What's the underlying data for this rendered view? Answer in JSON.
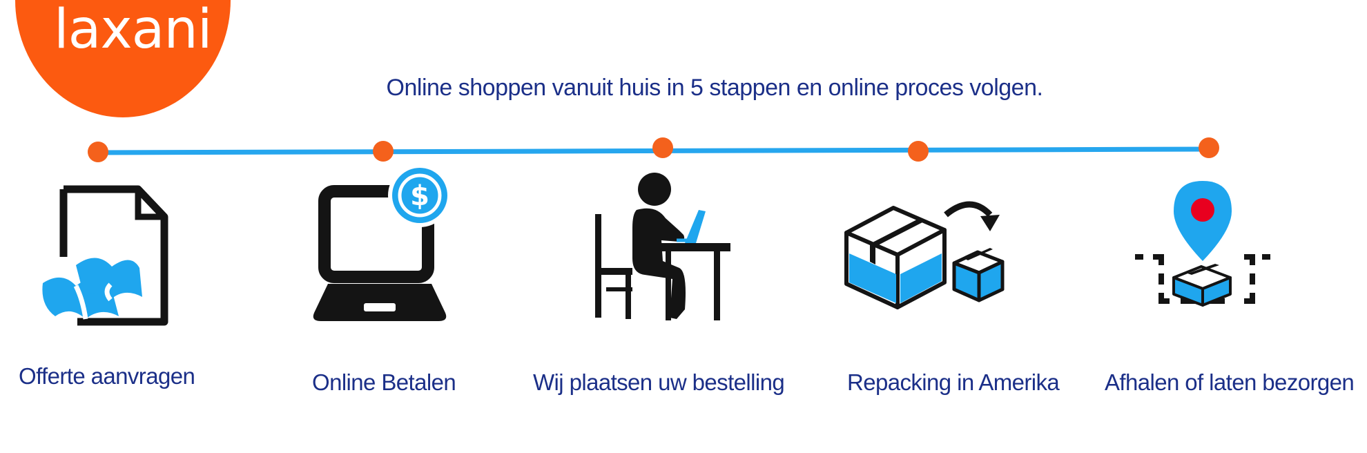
{
  "brand": {
    "name": "laxani",
    "color": "#fc5a10"
  },
  "headline": "Online shoppen vanuit huis in 5 stappen en online proces volgen.",
  "colors": {
    "text": "#1b2f88",
    "line": "#26a6ee",
    "dot": "#f4611c",
    "icon_blue": "#1fa6ee",
    "icon_dark": "#141414"
  },
  "steps": [
    {
      "label": "Offerte aanvragen",
      "icon": "quote-document-icon"
    },
    {
      "label": "Online Betalen",
      "icon": "laptop-payment-icon"
    },
    {
      "label": "Wij plaatsen uw bestelling",
      "icon": "person-ordering-icon"
    },
    {
      "label": "Repacking in Amerika",
      "icon": "repacking-boxes-icon"
    },
    {
      "label": "Afhalen of laten bezorgen",
      "icon": "pickup-location-icon"
    }
  ]
}
